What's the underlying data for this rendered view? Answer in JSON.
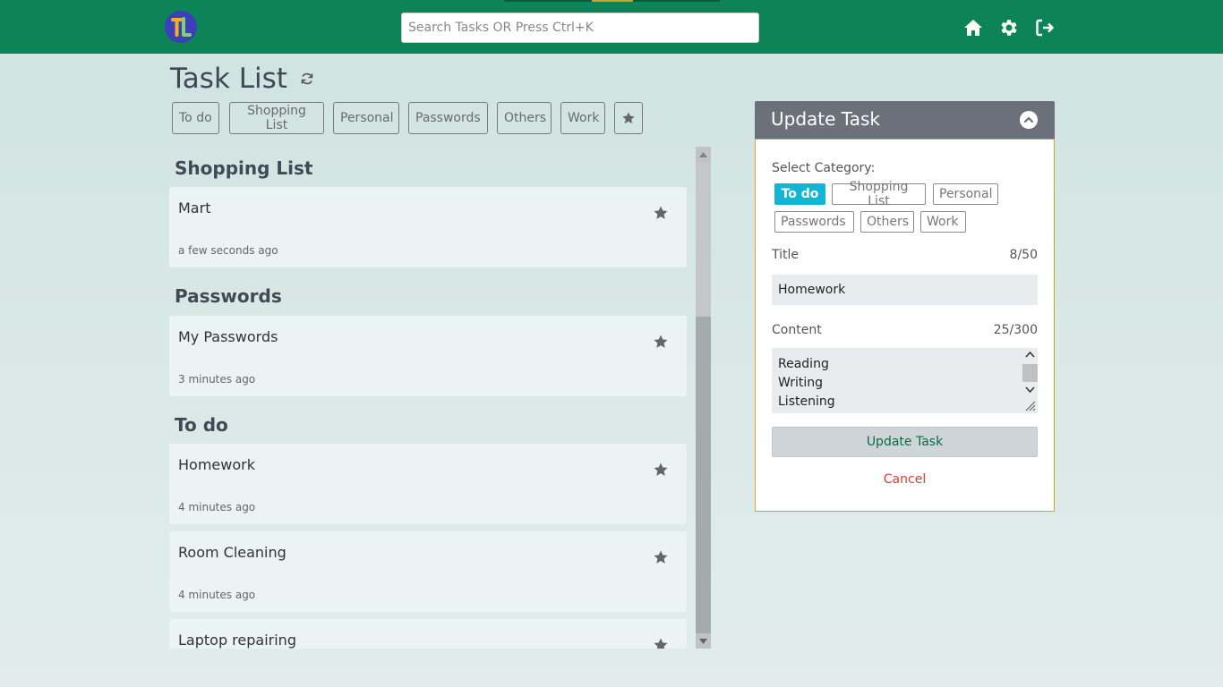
{
  "colors": {
    "topbar": "#0d8457",
    "active_category": "#12b5d6",
    "panel_header": "#6b707b",
    "panel_border": "#e0a020",
    "cancel": "#e03a2f",
    "update_text": "#0d6d45"
  },
  "header": {
    "logo_icon": "app-logo-icon",
    "search_placeholder": "Search Tasks OR Press Ctrl+K",
    "icons": [
      "home-icon",
      "gear-icon",
      "logout-icon"
    ]
  },
  "main": {
    "title": "Task List",
    "filters": [
      "To do",
      "Shopping List",
      "Personal",
      "Passwords",
      "Others",
      "Work"
    ],
    "sections": [
      {
        "title": "Shopping List",
        "tasks": [
          {
            "title": "Mart",
            "time": "a few seconds ago"
          }
        ]
      },
      {
        "title": "Passwords",
        "tasks": [
          {
            "title": "My Passwords",
            "time": "3 minutes ago"
          }
        ]
      },
      {
        "title": "To do",
        "tasks": [
          {
            "title": "Homework",
            "time": "4 minutes ago"
          },
          {
            "title": "Room Cleaning",
            "time": "4 minutes ago"
          },
          {
            "title": "Laptop repairing",
            "time": ""
          }
        ]
      }
    ]
  },
  "panel": {
    "title": "Update Task",
    "select_category_label": "Select Category:",
    "categories": [
      "To do",
      "Shopping List",
      "Personal",
      "Passwords",
      "Others",
      "Work"
    ],
    "selected_category": "To do",
    "title_label": "Title",
    "title_count": "8/50",
    "title_value": "Homework",
    "content_label": "Content",
    "content_count": "25/300",
    "content_lines": [
      "Reading",
      "Writing",
      "Listening"
    ],
    "update_label": "Update Task",
    "cancel_label": "Cancel"
  }
}
